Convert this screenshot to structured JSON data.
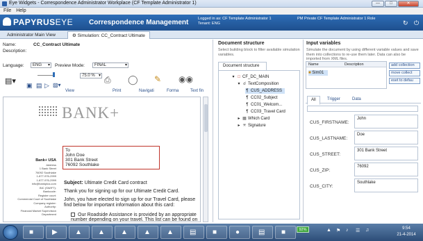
{
  "window": {
    "title": "Eye Widgets - Correspondence Administrator Workplace (CF Template Administrator 1)",
    "controls": [
      "minimize",
      "maximize",
      "close"
    ]
  },
  "menubar": {
    "items": [
      "File",
      "Help"
    ]
  },
  "header": {
    "logo_main": "PAPYRUS",
    "logo_eye": "EYE",
    "product": "Correspondence Management",
    "login_line1": "Logged in as: CF Template Administrator 1",
    "login_line2": "Tenant: ENG",
    "template_info": "PM Private CF Template Administrator 1 Role",
    "icons": [
      "refresh-icon",
      "power-icon"
    ]
  },
  "tabs": [
    {
      "label": "Administrator Main View",
      "active": false
    },
    {
      "label": "Simulation: CC_Contract Ultimate",
      "active": true
    }
  ],
  "left": {
    "name_label": "Name:",
    "name_value": "CC_Contract Ultimate",
    "description_label": "Description:",
    "language_label": "Language:",
    "language_value": "ENG",
    "preview_label": "Preview Mode:",
    "preview_value": "FINAL",
    "zoom": "75.0 %",
    "toolbar_labels": {
      "view": "View",
      "print": "Print",
      "navigation": "Navigati",
      "format": "Forma",
      "text": "Text fin"
    }
  },
  "document": {
    "bank_name": "BANK+",
    "address": {
      "to": "To",
      "name": "John Doe",
      "street": "301 Bank Street",
      "city": "76092 Southlake"
    },
    "side_bank": "Bank+ USA",
    "side_lines": [
      "Address",
      "1 Bank Street",
      "76092 Southlake",
      "1-877-976-2999",
      "1-877-976-2999",
      "info@bankplus.com",
      "BIC (SWIFT):",
      "Bankcode:",
      "Register court:",
      "Commercial Court of Southlake",
      "Company register:",
      "Authority:",
      "Financial Market Supervision Department"
    ],
    "subject_label": "Subject:",
    "subject_text": "Ultimate Credit Card contract",
    "para1": "Thank you for signing up for our Ultimate Credit Card.",
    "para2": "John, you have elected to sign up for our Travel Card, please find below for important information about this card:",
    "checkbox_item": "Our Roadside Assistance is provided by an appropriate number depending on your travel. This list can be found on our"
  },
  "middle": {
    "title": "Document structure",
    "description": "Select building block to filter available simulation variables.",
    "subtab": "Document structure",
    "tree": [
      {
        "label": "CF_DC_MAIN",
        "icon": "document-icon",
        "expander": "▾",
        "level": 0,
        "selected": false
      },
      {
        "label": "TextComposition",
        "icon": "composition-icon",
        "expander": "▾",
        "level": 1,
        "selected": false
      },
      {
        "label": "CUS_ADDRESS",
        "icon": "paragraph-icon",
        "expander": "",
        "level": 2,
        "selected": true
      },
      {
        "label": "CC02_Subject",
        "icon": "paragraph-icon",
        "expander": "",
        "level": 2,
        "selected": false
      },
      {
        "label": "CC01_Welcom...",
        "icon": "paragraph-icon",
        "expander": "",
        "level": 2,
        "selected": false
      },
      {
        "label": "CC03_Travel Card",
        "icon": "paragraph-icon",
        "expander": "",
        "level": 2,
        "selected": false
      },
      {
        "label": "Which Card",
        "icon": "switch-icon",
        "expander": "▸",
        "level": 1,
        "selected": false
      },
      {
        "label": "Signature",
        "icon": "signature-icon",
        "expander": "▸",
        "level": 1,
        "selected": false
      }
    ]
  },
  "right": {
    "title": "Input variables",
    "description": "Simulate the document by using different variable values and save them into collections to re-use them later. Data can also be imported from XML files.",
    "table_headers": [
      "Name",
      "Description"
    ],
    "table_rows": [
      {
        "name": "Sim01",
        "description": ""
      }
    ],
    "side_buttons": [
      "add collection",
      "move collect",
      "eset to defau"
    ],
    "tabs": [
      "All",
      "Trigger",
      "Data"
    ],
    "active_tab": "All",
    "variables": [
      {
        "label": "CUS_FIRSTNAME:",
        "value": "John"
      },
      {
        "label": "CUS_LASTNAME:",
        "value": "Doe"
      },
      {
        "label": "CUS_STREET:",
        "value": "301 Bank Street"
      },
      {
        "label": "CUS_ZIP:",
        "value": "76092"
      },
      {
        "label": "CUS_CITY:",
        "value": "Southlake"
      }
    ]
  },
  "taskbar": {
    "battery": "92%",
    "time": "9:54",
    "date": "21-4-2014"
  },
  "colors": {
    "header_blue": "#2e6eb7",
    "address_border": "#c0342a",
    "selection": "#cfe2f7"
  }
}
